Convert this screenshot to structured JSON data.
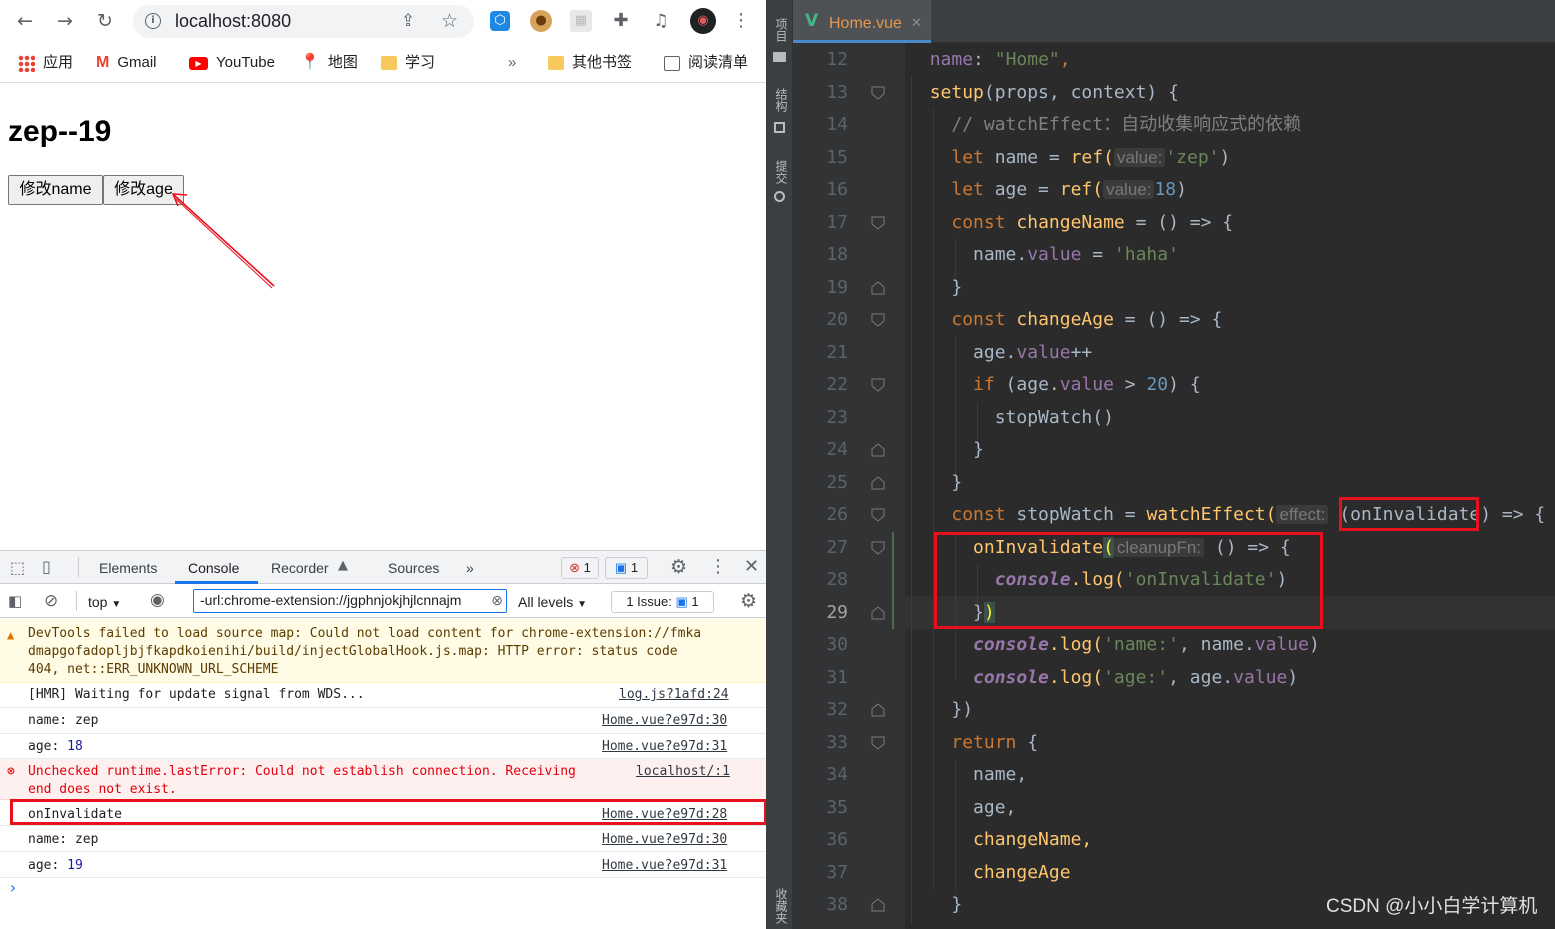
{
  "browser": {
    "url": "localhost:8080",
    "bookmarks": [
      {
        "label": "应用",
        "icon": "apps-grid-icon"
      },
      {
        "label": "Gmail",
        "icon": "gmail-icon"
      },
      {
        "label": "YouTube",
        "icon": "youtube-icon"
      },
      {
        "label": "地图",
        "icon": "maps-icon"
      },
      {
        "label": "学习",
        "icon": "folder-icon"
      },
      {
        "label": "»",
        "icon": ""
      },
      {
        "label": "其他书签",
        "icon": "folder-icon"
      },
      {
        "label": "阅读清单",
        "icon": "reading-list-icon"
      }
    ]
  },
  "page": {
    "heading": "zep--19",
    "buttons": [
      "修改name",
      "修改age"
    ]
  },
  "devtools": {
    "tabs": [
      "Elements",
      "Console",
      "Recorder",
      "Sources",
      "»"
    ],
    "active_tab": "Console",
    "error_count": "1",
    "message_count": "1",
    "context": "top",
    "filter_value": "-url:chrome-extension://jgphnjokjhjlcnnajm",
    "levels": "All levels",
    "issues": "1 Issue:",
    "issues_count": "1",
    "console": [
      {
        "type": "warning",
        "lines": [
          "DevTools failed to load source map: Could not load content for chrome-extension://fmka",
          "dmapgofadopljbjfkapdkoienihi/build/injectGlobalHook.js.map: HTTP error: status code",
          "404, net::ERR_UNKNOWN_URL_SCHEME"
        ],
        "source": ""
      },
      {
        "type": "log",
        "text": "[HMR] Waiting for update signal from WDS...",
        "source": "log.js?1afd:24"
      },
      {
        "type": "log",
        "label": "name: ",
        "value": "zep",
        "source": "Home.vue?e97d:30"
      },
      {
        "type": "log",
        "label": "age: ",
        "value": "18",
        "source": "Home.vue?e97d:31"
      },
      {
        "type": "error",
        "lines": [
          "Unchecked runtime.lastError: Could not establish connection. Receiving",
          "end does not exist."
        ],
        "source": "localhost/:1"
      },
      {
        "type": "log",
        "text": "onInvalidate",
        "source": "Home.vue?e97d:28"
      },
      {
        "type": "log",
        "label": "name: ",
        "value": "zep",
        "source": "Home.vue?e97d:30"
      },
      {
        "type": "log",
        "label": "age: ",
        "value": "19",
        "source": "Home.vue?e97d:31"
      }
    ],
    "prompt": "›"
  },
  "ide": {
    "file_tab": "Home.vue",
    "side_tabs": [
      "项目",
      "结构",
      "提交",
      "收藏夹"
    ],
    "current_line": 29,
    "line_numbers": [
      "12",
      "13",
      "14",
      "15",
      "16",
      "17",
      "18",
      "19",
      "20",
      "21",
      "22",
      "23",
      "24",
      "25",
      "26",
      "27",
      "28",
      "29",
      "30",
      "31",
      "32",
      "33",
      "34",
      "35",
      "36",
      "37",
      "38"
    ],
    "code": {
      "l12_key": "name",
      "l12_val": "\"Home\"",
      "l13_fn": "setup",
      "l13_params": "(props, context) {",
      "l14_comment": "// watchEffect：自动收集响应式的依赖",
      "hint_value": "value:",
      "l15_a": "let",
      "l15_b": " name = ",
      "l15_c": "ref(",
      "l15_d": "'zep'",
      "l15_e": ")",
      "l16_a": "let",
      "l16_b": " age = ",
      "l16_c": "ref(",
      "l16_d": "18",
      "l16_e": ")",
      "l17_a": "const",
      "l17_b": "changeName",
      "l17_c": " = () => {",
      "l18_a": "name.",
      "l18_b": "value",
      "l18_c": " = ",
      "l18_d": "'haha'",
      "l19": "}",
      "l20_a": "const",
      "l20_b": "changeAge",
      "l20_c": " = () => {",
      "l21_a": "age.",
      "l21_b": "value",
      "l21_c": "++",
      "l22_a": "if",
      "l22_b": " (age.",
      "l22_c": "value",
      "l22_d": " > ",
      "l22_e": "20",
      "l22_f": ") {",
      "l23": "stopWatch()",
      "l24": "}",
      "l25": "}",
      "l26_a": "const",
      "l26_b": " stopWatch = ",
      "l26_c": "watchEffect(",
      "l26_hint": "effect:",
      "l26_d": "(",
      "l26_e": "onInvalidate",
      "l26_f": ") => {",
      "l27_a": "onInvalidate",
      "l27_b": "(",
      "l27_hint": "cleanupFn:",
      "l27_c": " () => {",
      "l28_a": "console",
      "l28_b": ".log(",
      "l28_c": "'onInvalidate'",
      "l28_d": ")",
      "l29_a": "}",
      "l29_b": ")",
      "l30_a": "console",
      "l30_b": ".log(",
      "l30_c": "'name:'",
      "l30_d": ", name.",
      "l30_e": "value",
      "l30_f": ")",
      "l31_a": "console",
      "l31_b": ".log(",
      "l31_c": "'age:'",
      "l31_d": ", age.",
      "l31_e": "value",
      "l31_f": ")",
      "l32": "})",
      "l33_a": "return",
      "l33_b": " {",
      "l34": "name,",
      "l35": "age,",
      "l36": "changeName,",
      "l37": "changeAge",
      "l38": "}"
    }
  },
  "watermark": "CSDN @小小白学计算机",
  "colors": {
    "annotation_red": "#e8101c",
    "accent_blue": "#1a73e8",
    "ide_bg": "#2b2b2b"
  }
}
